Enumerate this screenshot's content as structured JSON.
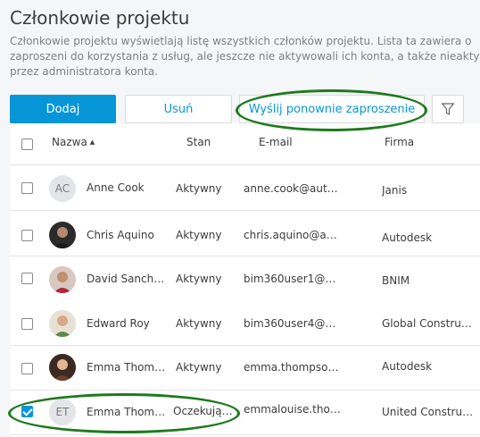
{
  "page": {
    "title": "Członkowie projektu",
    "description": [
      "Członkowie projektu wyświetlają listę wszystkich członków projektu. Lista ta zawiera o",
      "zaproszeni do korzystania z usług, ale jeszcze nie aktywowali ich konta, a także nieakty",
      "przez administratora konta."
    ]
  },
  "toolbar": {
    "add_label": "Dodaj",
    "remove_label": "Usuń",
    "resend_label": "Wyślij ponownie zaproszenie",
    "filter_icon": "filter-icon"
  },
  "table": {
    "columns": {
      "name": "Nazwa",
      "status": "Stan",
      "email": "E-mail",
      "company": "Firma"
    },
    "sort": "ascending",
    "rows": [
      {
        "initials": "AC",
        "name": "Anne Cook",
        "status": "Aktywny",
        "email": "anne.cook@auto…",
        "company": "Janis",
        "checked": false
      },
      {
        "initials": "",
        "name": "Chris Aquino",
        "status": "Aktywny",
        "email": "chris.aquino@au…",
        "company": "Autodesk",
        "checked": false
      },
      {
        "initials": "",
        "name": "David Sanch…",
        "status": "Aktywny",
        "email": "bim360user1@ya…",
        "company": "BNIM",
        "checked": false
      },
      {
        "initials": "",
        "name": "Edward Roy",
        "status": "Aktywny",
        "email": "bim360user4@y…",
        "company": "Global Constru…",
        "checked": false
      },
      {
        "initials": "",
        "name": "Emma Thom…",
        "status": "Aktywny",
        "email": "emma.thompson…",
        "company": "Autodesk",
        "checked": false
      },
      {
        "initials": "ET",
        "name": "Emma Thom…",
        "status": "Oczekują…",
        "email": "emmalouise.tho…",
        "company": "United Constru…",
        "checked": true
      }
    ]
  },
  "colors": {
    "accent": "#0696d7",
    "annotation": "#1d7a1d"
  }
}
